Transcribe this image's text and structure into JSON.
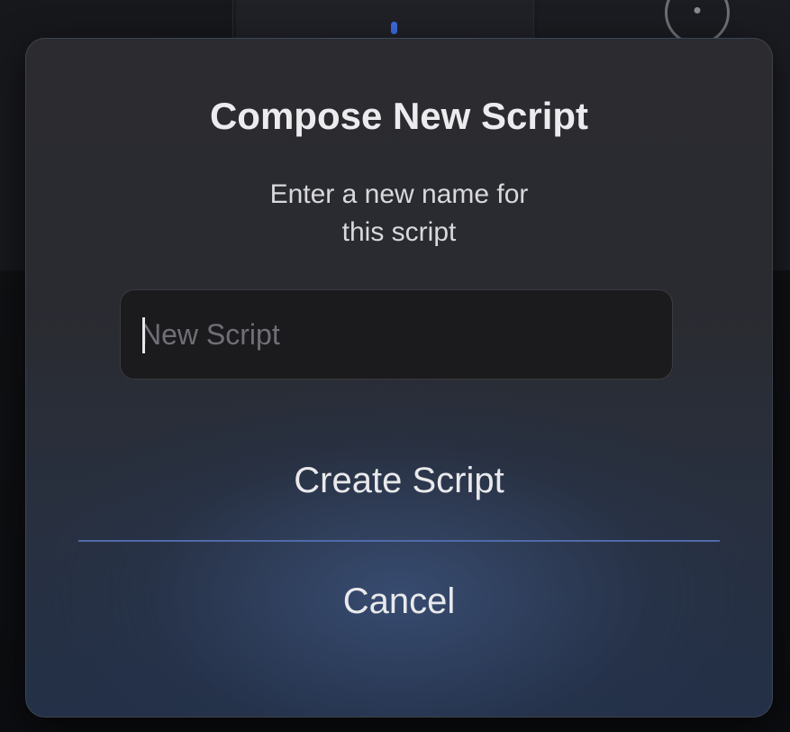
{
  "dialog": {
    "title": "Compose New Script",
    "subtitle_line1": "Enter a new name for",
    "subtitle_line2": "this script",
    "input": {
      "value": "",
      "placeholder": "New Script"
    },
    "primary_button_label": "Create Script",
    "secondary_button_label": "Cancel"
  },
  "colors": {
    "accent": "#4f6aa8",
    "dialog_background": "#2b2b30",
    "text": "#ececee"
  }
}
